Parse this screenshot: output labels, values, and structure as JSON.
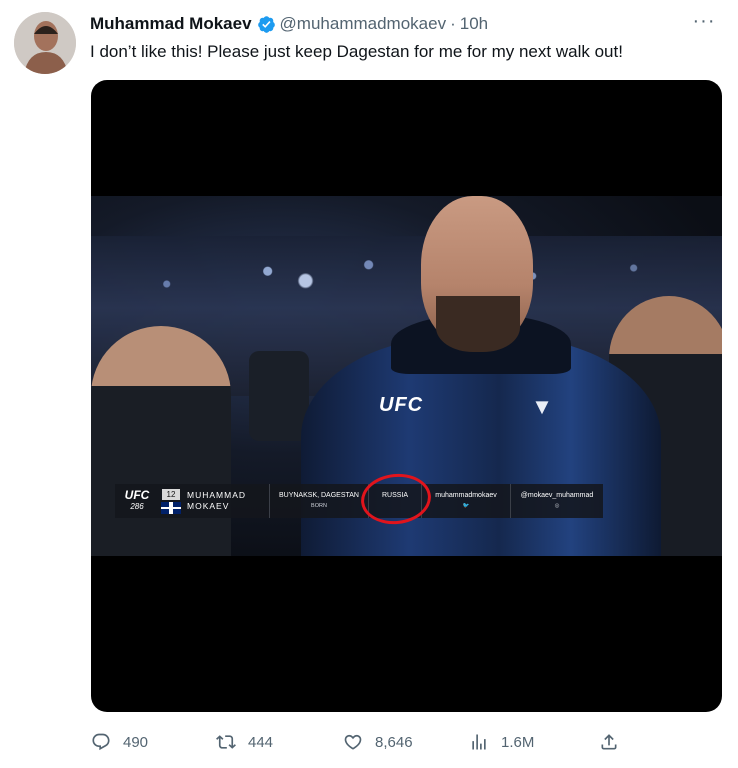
{
  "tweet": {
    "author_name": "Muhammad Mokaev",
    "handle": "@muhammadmokaev",
    "separator": "·",
    "time": "10h",
    "more_icon_text": "···",
    "text": "I don’t like this! Please just keep Dagestan for me for my next walk out!"
  },
  "media": {
    "jacket_text": "UFC",
    "lower_third": {
      "event_logo": "UFC",
      "event_number": "286",
      "rank": "12",
      "name_first": "MUHAMMAD",
      "name_last": "MOKAEV",
      "born_place": "BUYNAKSK, DAGESTAN",
      "born_country": "RUSSIA",
      "born_label": "BORN",
      "twitter": "muhammadmokaev",
      "instagram": "@mokaev_muhammad"
    }
  },
  "actions": {
    "replies": "490",
    "retweets": "444",
    "likes": "8,646",
    "views": "1.6M"
  },
  "colors": {
    "verified": "#1d9bf0",
    "secondary_text": "#536471",
    "highlight_circle": "#e1141c"
  }
}
